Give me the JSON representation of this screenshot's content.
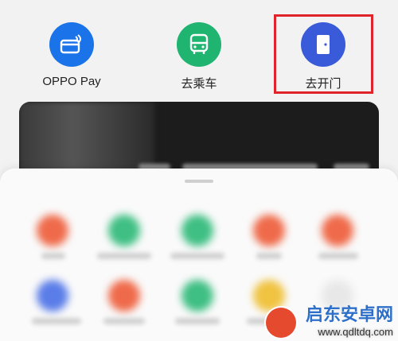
{
  "actions": [
    {
      "label": "OPPO Pay",
      "icon": "card-icon",
      "color": "#1a73e8"
    },
    {
      "label": "去乘车",
      "icon": "bus-icon",
      "color": "#1fb470"
    },
    {
      "label": "去开门",
      "icon": "door-icon",
      "color": "#3a5bd9"
    }
  ],
  "watermark": {
    "title": "启东安卓网",
    "url": "www.qdltdq.com"
  }
}
